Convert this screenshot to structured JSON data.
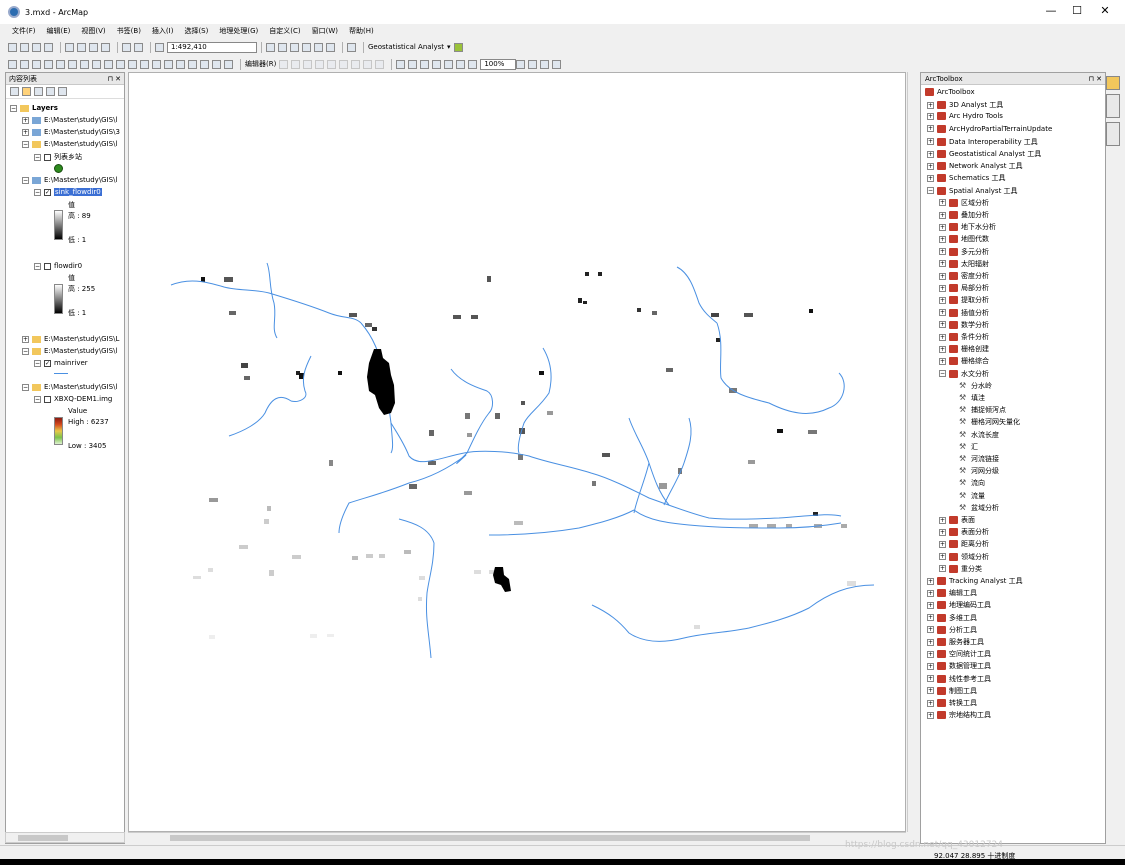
{
  "window": {
    "title": "3.mxd - ArcMap"
  },
  "menu": [
    "文件(F)",
    "编辑(E)",
    "视图(V)",
    "书签(B)",
    "插入(I)",
    "选择(S)",
    "地理处理(G)",
    "自定义(C)",
    "窗口(W)",
    "帮助(H)"
  ],
  "toolbar": {
    "scale": "1:492,410",
    "geostat_label": "Geostatistical Analyst",
    "editor_label": "编辑器(R)",
    "zoom": "100%"
  },
  "toc": {
    "title": "内容列表",
    "root": "Layers",
    "layers": [
      {
        "label": "E:\\Master\\study\\GIS\\l"
      },
      {
        "label": "E:\\Master\\study\\GIS\\3"
      },
      {
        "label": "E:\\Master\\study\\GIS\\l"
      },
      {
        "label": "列表乡站"
      },
      {
        "label": "E:\\Master\\study\\GIS\\l"
      },
      {
        "label": "sink_flowdir0"
      },
      {
        "label": "值"
      },
      {
        "label": "高 : 89"
      },
      {
        "label": "低 : 1"
      },
      {
        "label": "flowdir0"
      },
      {
        "label": "值"
      },
      {
        "label": "高 : 255"
      },
      {
        "label": "低 : 1"
      },
      {
        "label": "E:\\Master\\study\\GIS\\L"
      },
      {
        "label": "E:\\Master\\study\\GIS\\l"
      },
      {
        "label": "mainriver"
      },
      {
        "label": "E:\\Master\\study\\GIS\\l"
      },
      {
        "label": "XBXQ-DEM1.img"
      },
      {
        "label": "Value"
      },
      {
        "label": "High : 6237"
      },
      {
        "label": "Low : 3405"
      }
    ]
  },
  "toolbox": {
    "title": "ArcToolbox",
    "root": "ArcToolbox",
    "items": [
      "3D Analyst 工具",
      "Arc Hydro Tools",
      "ArcHydroPartialTerrainUpdate",
      "Data Interoperability 工具",
      "Geostatistical Analyst 工具",
      "Network Analyst 工具",
      "Schematics 工具",
      "Spatial Analyst 工具"
    ],
    "spatial_children": [
      "区域分析",
      "叠加分析",
      "地下水分析",
      "地图代数",
      "多元分析",
      "太阳辐射",
      "密度分析",
      "局部分析",
      "提取分析",
      "插值分析",
      "数学分析",
      "条件分析",
      "栅格创建",
      "栅格综合",
      "水文分析"
    ],
    "hydro_tools": [
      "分水岭",
      "填洼",
      "捕捉倾泻点",
      "栅格河网矢量化",
      "水流长度",
      "汇",
      "河流链接",
      "河网分级",
      "流向",
      "流量",
      "盆域分析"
    ],
    "spatial_after": [
      "表面",
      "表面分析",
      "距离分析",
      "领域分析",
      "重分类"
    ],
    "other_items": [
      "Tracking Analyst 工具",
      "编辑工具",
      "地理编码工具",
      "多维工具",
      "分析工具",
      "服务器工具",
      "空间统计工具",
      "数据管理工具",
      "线性参考工具",
      "制图工具",
      "转换工具",
      "宗地结构工具"
    ]
  },
  "status": {
    "coords": "92.047  28.895 十进制度"
  },
  "watermark": "https://blog.csdn.net/qq_43012724",
  "colors": {
    "river": "#4a90e2",
    "selection": "#3b6fd4",
    "toolbox_icon": "#c23a2b"
  }
}
